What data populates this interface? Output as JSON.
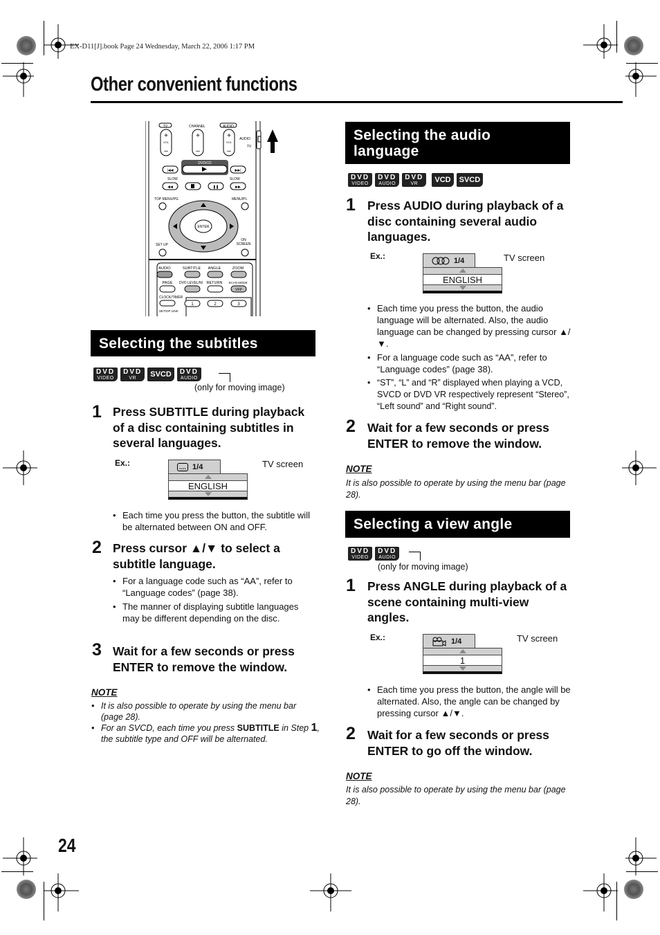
{
  "book_header": "EX-D11[J].book  Page 24  Wednesday, March 22, 2006  1:17 PM",
  "page_title": "Other convenient functions",
  "page_number": "24",
  "remote": {
    "labels": {
      "tv": "TV",
      "channel": "CHANNEL",
      "audio_top": "AUDIO",
      "vol": "VOL",
      "switch_audio": "AUDIO",
      "switch_tv": "TV",
      "dvdcd": "DVD/CD",
      "slow_left": "SLOW",
      "slow_right": "SLOW",
      "top_menu": "TOP MENU/PG",
      "menu": "MENU/PL",
      "enter": "ENTER",
      "setup": "SET UP",
      "on_screen_1": "ON",
      "on_screen_2": "SCREEN",
      "audio": "AUDIO",
      "subtitle": "SUBTITLE",
      "angle": "ANGLE",
      "zoom": "ZOOM",
      "page": "PAGE",
      "dvd_level": "DVD LEVEL/NI",
      "return": "RETURN",
      "scan_mode": "SCAN MODE",
      "vfp": "VFP",
      "clock_timer": "CLOCK/TIMER",
      "set_op_link": "SET/OP LINK",
      "num1": "1",
      "num2": "2",
      "num3": "3"
    }
  },
  "subtitles": {
    "title": "Selecting the subtitles",
    "badges": [
      {
        "top": "DVD",
        "bottom": "VIDEO"
      },
      {
        "top": "DVD",
        "bottom": "VR"
      },
      {
        "top": "SVCD",
        "bottom": ""
      },
      {
        "top": "DVD",
        "bottom": "AUDIO"
      }
    ],
    "badge_note": "(only for moving image)",
    "steps": [
      {
        "num": "1",
        "text": "Press SUBTITLE during playback of a disc containing subtitles in several languages.",
        "example": {
          "ex_label": "Ex.:",
          "tv_label": "TV screen",
          "icon": "subtitle-icon",
          "icon_glyph": "....",
          "count": "1/4",
          "value": "ENGLISH"
        },
        "bullets": [
          "Each time you press the button, the subtitle will be alternated between ON and OFF."
        ]
      },
      {
        "num": "2",
        "text": "Press cursor ▲/▼ to select a subtitle language.",
        "bullets": [
          "For a language code such as “AA”, refer to “Language codes” (page 38).",
          "The manner of displaying subtitle languages may be different depending on the disc."
        ]
      },
      {
        "num": "3",
        "text": "Wait for a few seconds or press ENTER to remove the window."
      }
    ],
    "note": {
      "heading": "NOTE",
      "items": [
        "It is also possible to operate by using the menu bar (page 28).",
        {
          "pre": "For an SVCD, each time you press ",
          "bold": "SUBTITLE",
          "mid": " in Step ",
          "step": "1",
          "post": ", the subtitle type and OFF will be alternated."
        }
      ]
    }
  },
  "audio": {
    "title": "Selecting the audio language",
    "badges": [
      {
        "top": "DVD",
        "bottom": "VIDEO"
      },
      {
        "top": "DVD",
        "bottom": "AUDIO"
      },
      {
        "top": "DVD",
        "bottom": "VR"
      },
      {
        "top": "VCD",
        "bottom": ""
      },
      {
        "top": "SVCD",
        "bottom": ""
      }
    ],
    "steps": [
      {
        "num": "1",
        "text": "Press AUDIO during playback of a disc containing several audio languages.",
        "example": {
          "ex_label": "Ex.:",
          "tv_label": "TV screen",
          "icon": "audio-icon",
          "count": "1/4",
          "value": "ENGLISH"
        },
        "bullets": [
          "Each time you press the button, the audio language will be alternated. Also, the audio language can be changed by pressing cursor ▲/▼.",
          "For a language code such as “AA”, refer to “Language codes” (page 38).",
          "“ST”, “L” and “R” displayed when playing a VCD, SVCD or DVD VR respectively represent “Stereo”, “Left sound” and “Right sound”."
        ]
      },
      {
        "num": "2",
        "text": "Wait for a few seconds or press ENTER to remove the window."
      }
    ],
    "note": {
      "heading": "NOTE",
      "text": "It is also possible to operate by using the menu bar (page 28)."
    }
  },
  "angle": {
    "title": "Selecting a view angle",
    "badges": [
      {
        "top": "DVD",
        "bottom": "VIDEO"
      },
      {
        "top": "DVD",
        "bottom": "AUDIO"
      }
    ],
    "badge_note": "(only for moving image)",
    "steps": [
      {
        "num": "1",
        "text": "Press ANGLE during playback of a scene containing multi-view angles.",
        "example": {
          "ex_label": "Ex.:",
          "tv_label": "TV screen",
          "icon": "camera-icon",
          "count": "1/4",
          "value": "1"
        },
        "bullets": [
          "Each time you press the button, the angle will be alternated. Also, the angle can be changed by pressing cursor ▲/▼."
        ]
      },
      {
        "num": "2",
        "text": "Wait for a few seconds or press ENTER to go off the window."
      }
    ],
    "note": {
      "heading": "NOTE",
      "text": "It is also possible to operate by using the menu bar (page 28)."
    }
  }
}
